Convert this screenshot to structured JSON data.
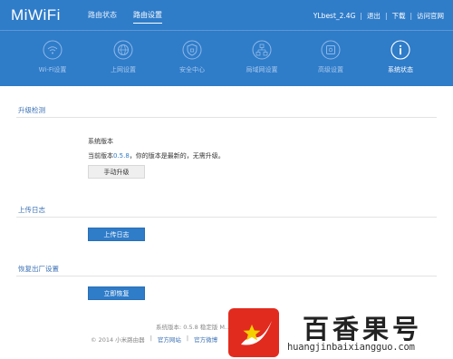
{
  "header": {
    "logo": "MiWiFi",
    "nav": [
      {
        "label": "路由状态"
      },
      {
        "label": "路由设置"
      }
    ],
    "topright": {
      "ssid": "YLbest_2.4G",
      "logout": "退出",
      "download": "下载",
      "official": "访问官网"
    }
  },
  "mainnav": [
    {
      "label": "Wi-Fi设置",
      "icon": "wifi-icon"
    },
    {
      "label": "上网设置",
      "icon": "globe-icon"
    },
    {
      "label": "安全中心",
      "icon": "shield-icon"
    },
    {
      "label": "局域网设置",
      "icon": "network-icon"
    },
    {
      "label": "高级设置",
      "icon": "gear-box-icon"
    },
    {
      "label": "系统状态",
      "icon": "info-icon"
    }
  ],
  "upgrade": {
    "title": "升级检测",
    "version_label": "系统版本",
    "current_prefix": "当前版本",
    "current_version": "0.5.8",
    "current_suffix": "，你的版本是最新的，无需升级。",
    "manual_button": "手动升级"
  },
  "log": {
    "title": "上传日志",
    "button": "上传日志"
  },
  "reset": {
    "title": "恢复出厂设置",
    "button": "立即恢复"
  },
  "footer": {
    "line1": "系统版本: 0.5.8 稳定版 M...",
    "copyright": "© 2014 小米路由器",
    "sep": "|",
    "site": "官方网站",
    "weibo": "官方微博"
  },
  "watermark": {
    "title": "百香果号",
    "url": "huangjinbaixiangguo.com"
  },
  "colors": {
    "header": "#2f7cc9",
    "accent": "#3c72b4"
  }
}
